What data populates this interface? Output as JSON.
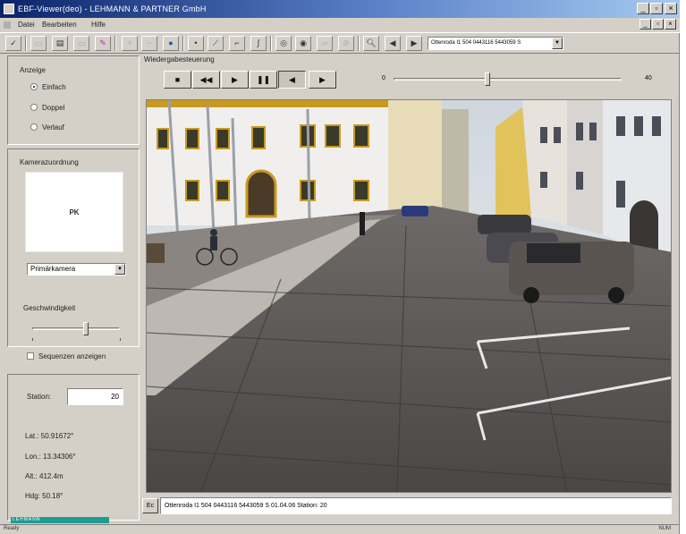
{
  "window": {
    "title": "EBF-Viewer(deo) - LEHMANN & PARTNER GmbH",
    "icons": {
      "app": "app-icon",
      "minimize": "minimize-icon",
      "restore": "restore-icon",
      "close": "close-icon"
    }
  },
  "menu": {
    "items": [
      "Datei",
      "Bearbeiten",
      "Hilfe"
    ]
  },
  "toolbar": {
    "station_select": "Ottenroda I1 504 0443116 5443059 S",
    "icons": [
      "check-icon",
      "zoom-out-icon",
      "zoom-in-icon",
      "stop-icon",
      "eraser-icon",
      "add-icon",
      "minus-icon",
      "globe-icon",
      "point-icon",
      "line-icon",
      "polyline-icon",
      "curve-icon",
      "measure-icon",
      "layer-icon",
      "disabled-icon-1",
      "disabled-icon-2",
      "magnifier-icon",
      "previous-icon",
      "next-icon"
    ]
  },
  "display": {
    "title": "Anzeige",
    "options": [
      {
        "label": "Einfach",
        "selected": true
      },
      {
        "label": "Doppel",
        "selected": false
      },
      {
        "label": "Verlauf",
        "selected": false
      }
    ]
  },
  "camera": {
    "title": "Kamerazuordnung",
    "compass_label": "PK",
    "select_value": "Primärkamera"
  },
  "speed": {
    "title": "Geschwindigkeit",
    "level": 0.53,
    "show_sequence_label": "Sequenzen anzeigen",
    "show_sequence_checked": false
  },
  "station": {
    "label": "Station:",
    "value": "20"
  },
  "info": {
    "lat": "Lat.: 50.91672°",
    "lon": "Lon.: 13.34306°",
    "alt": "Alt.: 412.4m",
    "hdg": "Hdg: 50.18°"
  },
  "logo_text": "LEHMANN",
  "viewer": {
    "title": "Wiedergabesteuerung",
    "buttons": [
      {
        "name": "first-button",
        "glyph": "■"
      },
      {
        "name": "rewind-button",
        "glyph": "◀◀"
      },
      {
        "name": "play-button",
        "glyph": "▶"
      },
      {
        "name": "pause-button",
        "glyph": "❚❚"
      },
      {
        "name": "step-back-button",
        "glyph": "◀"
      },
      {
        "name": "step-forward-button",
        "glyph": "▶"
      }
    ],
    "slider_min": "0",
    "slider_max": "40",
    "position": 0.42
  },
  "location": {
    "prefix": "Ec",
    "text": "Ottenroda I1 504 0443116 5443059 S 01.04.06 Station: 20"
  },
  "status": {
    "left": "Ready",
    "right": "NUM"
  }
}
